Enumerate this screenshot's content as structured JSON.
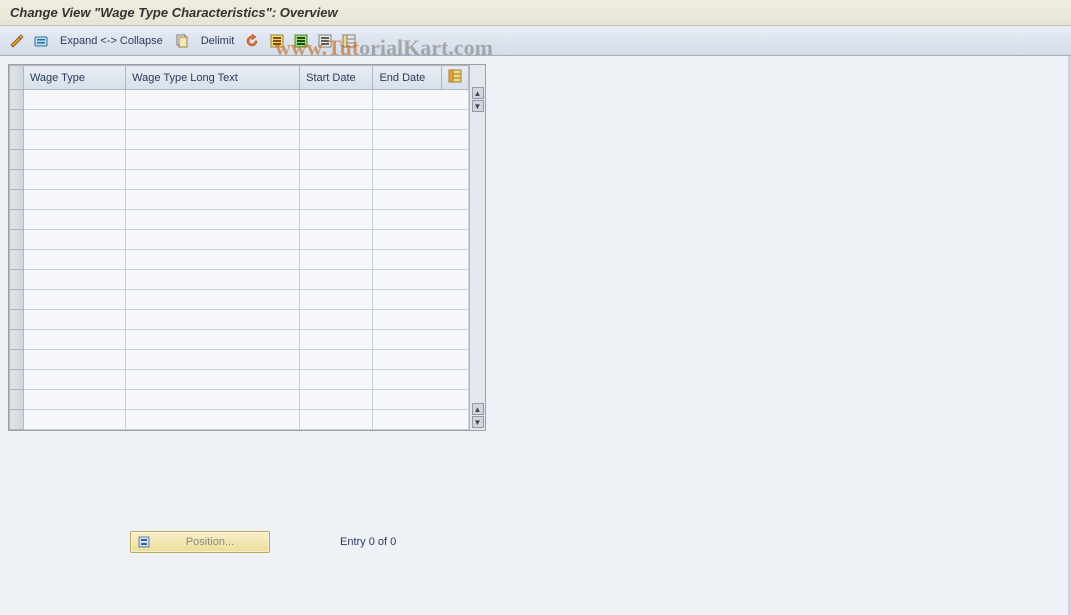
{
  "title": "Change View \"Wage Type Characteristics\": Overview",
  "toolbar": {
    "expand_collapse": "Expand <-> Collapse",
    "delimit": "Delimit"
  },
  "table": {
    "headers": {
      "wage_type": "Wage Type",
      "long_text": "Wage Type Long Text",
      "start_date": "Start Date",
      "end_date": "End Date"
    },
    "rows": [
      {
        "wage_type": "",
        "long_text": "",
        "start_date": "",
        "end_date": ""
      },
      {
        "wage_type": "",
        "long_text": "",
        "start_date": "",
        "end_date": ""
      },
      {
        "wage_type": "",
        "long_text": "",
        "start_date": "",
        "end_date": ""
      },
      {
        "wage_type": "",
        "long_text": "",
        "start_date": "",
        "end_date": ""
      },
      {
        "wage_type": "",
        "long_text": "",
        "start_date": "",
        "end_date": ""
      },
      {
        "wage_type": "",
        "long_text": "",
        "start_date": "",
        "end_date": ""
      },
      {
        "wage_type": "",
        "long_text": "",
        "start_date": "",
        "end_date": ""
      },
      {
        "wage_type": "",
        "long_text": "",
        "start_date": "",
        "end_date": ""
      },
      {
        "wage_type": "",
        "long_text": "",
        "start_date": "",
        "end_date": ""
      },
      {
        "wage_type": "",
        "long_text": "",
        "start_date": "",
        "end_date": ""
      },
      {
        "wage_type": "",
        "long_text": "",
        "start_date": "",
        "end_date": ""
      },
      {
        "wage_type": "",
        "long_text": "",
        "start_date": "",
        "end_date": ""
      },
      {
        "wage_type": "",
        "long_text": "",
        "start_date": "",
        "end_date": ""
      },
      {
        "wage_type": "",
        "long_text": "",
        "start_date": "",
        "end_date": ""
      },
      {
        "wage_type": "",
        "long_text": "",
        "start_date": "",
        "end_date": ""
      },
      {
        "wage_type": "",
        "long_text": "",
        "start_date": "",
        "end_date": ""
      },
      {
        "wage_type": "",
        "long_text": "",
        "start_date": "",
        "end_date": ""
      }
    ]
  },
  "footer": {
    "position_label": "Position...",
    "entry_text": "Entry 0 of 0"
  },
  "watermark": {
    "part_a": "www.Tut",
    "part_b": "orialKart.com"
  }
}
